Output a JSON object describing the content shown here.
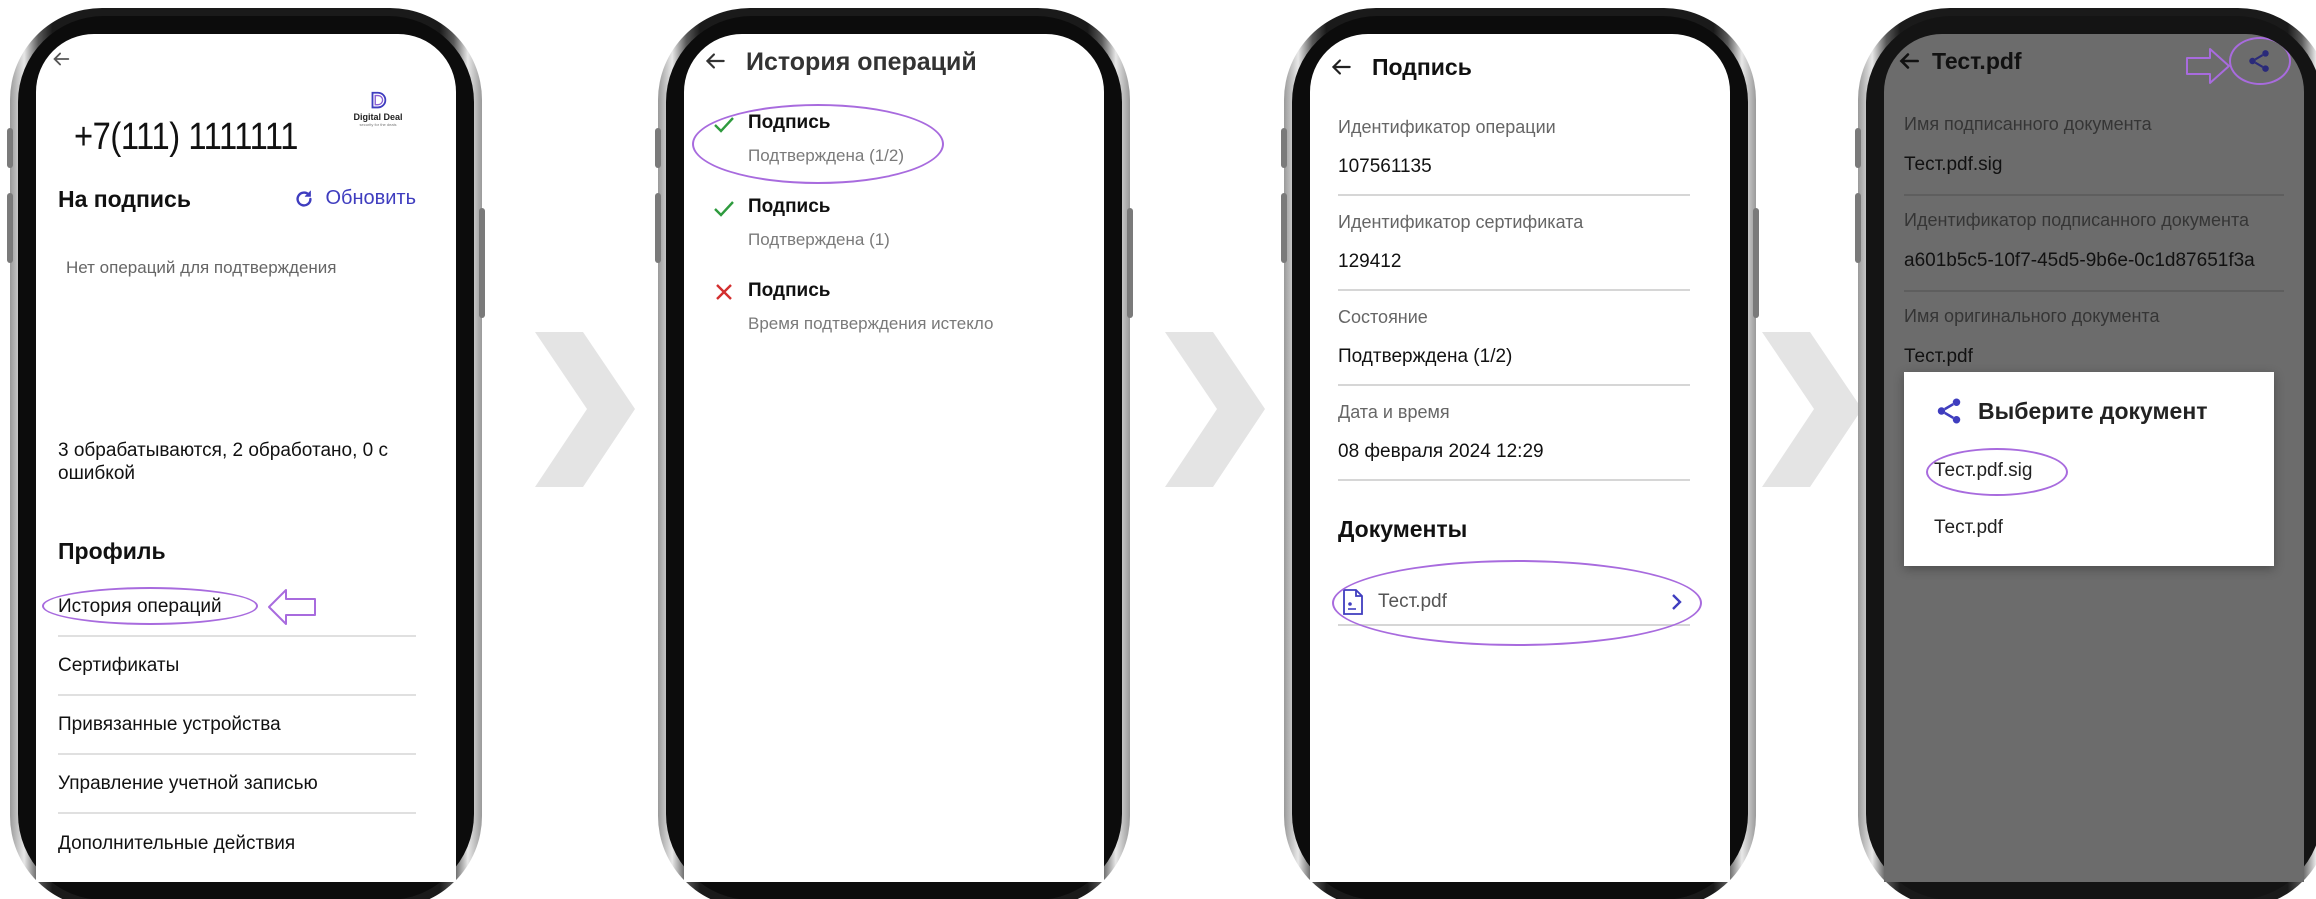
{
  "screen1": {
    "phone_number": "+7(111) 1111111",
    "logo_text": "Digital Deal",
    "logo_subtitle": "security for the deals",
    "sign_section_title": "На подпись",
    "refresh_label": "Обновить",
    "empty_text": "Нет операций для подтверждения",
    "stats_text": "3 обрабатываются, 2 обработано, 0 с ошибкой",
    "profile_title": "Профиль",
    "menu": [
      {
        "label": "История операций"
      },
      {
        "label": "Сертификаты"
      },
      {
        "label": "Привязанные устройства"
      },
      {
        "label": "Управление учетной записью"
      },
      {
        "label": "Дополнительные действия"
      }
    ]
  },
  "screen2": {
    "title": "История операций",
    "operations": [
      {
        "title": "Подпись",
        "status": "Подтверждена (1/2)",
        "state": "success"
      },
      {
        "title": "Подпись",
        "status": "Подтверждена (1)",
        "state": "success"
      },
      {
        "title": "Подпись",
        "status": "Время подтверждения истекло",
        "state": "failed"
      }
    ]
  },
  "screen3": {
    "title": "Подпись",
    "fields": [
      {
        "label": "Идентификатор операции",
        "value": "107561135"
      },
      {
        "label": "Идентификатор сертификата",
        "value": "129412"
      },
      {
        "label": "Состояние",
        "value": "Подтверждена (1/2)"
      },
      {
        "label": "Дата и время",
        "value": "08 февраля 2024 12:29"
      }
    ],
    "documents_title": "Документы",
    "document_name": "Тест.pdf"
  },
  "screen4": {
    "title": "Тест.pdf",
    "fields": [
      {
        "label": "Имя подписанного документа",
        "value": "Тест.pdf.sig"
      },
      {
        "label": "Идентификатор подписанного документа",
        "value": "a601b5c5-10f7-45d5-9b6e-0c1d87651f3a"
      },
      {
        "label": "Имя оригинального документа",
        "value": "Тест.pdf"
      }
    ],
    "dialog": {
      "title": "Выберите документ",
      "options": [
        {
          "label": "Тест.pdf.sig"
        },
        {
          "label": "Тест.pdf"
        }
      ]
    }
  },
  "colors": {
    "accent": "#3f3dbf",
    "success": "#2e9b3e",
    "error": "#d32f2f",
    "annotation": "#a86bde",
    "overlay": "#6c6c6c"
  }
}
